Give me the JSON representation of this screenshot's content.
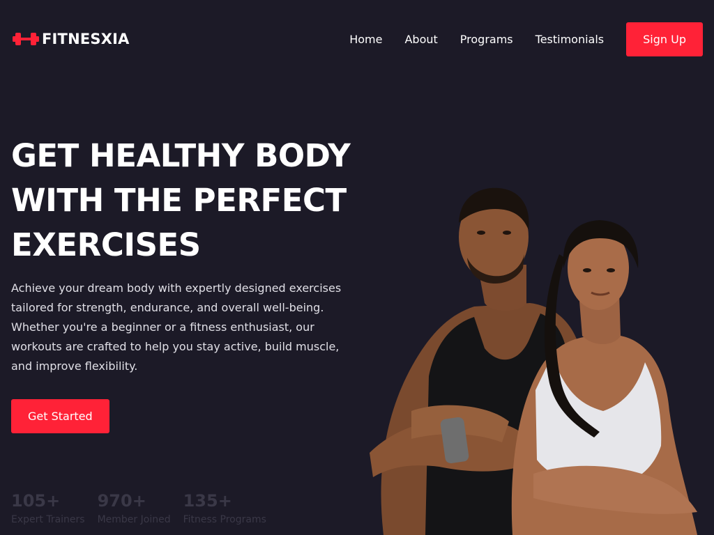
{
  "brand": {
    "name": "FITNESXIA",
    "logo_icon": "dumbbell-icon",
    "accent_color": "#ff2237"
  },
  "nav": {
    "items": [
      {
        "label": "Home"
      },
      {
        "label": "About"
      },
      {
        "label": "Programs"
      },
      {
        "label": "Testimonials"
      }
    ],
    "signup_label": "Sign Up"
  },
  "hero": {
    "title_line1": "GET HEALTHY BODY",
    "title_line2": "WITH THE PERFECT",
    "title_line3": "EXERCISES",
    "description": "Achieve your dream body with expertly designed exercises tailored for strength, endurance, and overall well-being. Whether you're a beginner or a fitness enthusiast, our workouts are crafted to help you stay active, build muscle, and improve flexibility.",
    "cta_label": "Get Started"
  },
  "stats": [
    {
      "value": "105+",
      "label": "Expert Trainers"
    },
    {
      "value": "970+",
      "label": "Member Joined"
    },
    {
      "value": "135+",
      "label": "Fitness Programs"
    }
  ],
  "colors": {
    "background": "#1c1a27",
    "button": "#ff2237"
  }
}
